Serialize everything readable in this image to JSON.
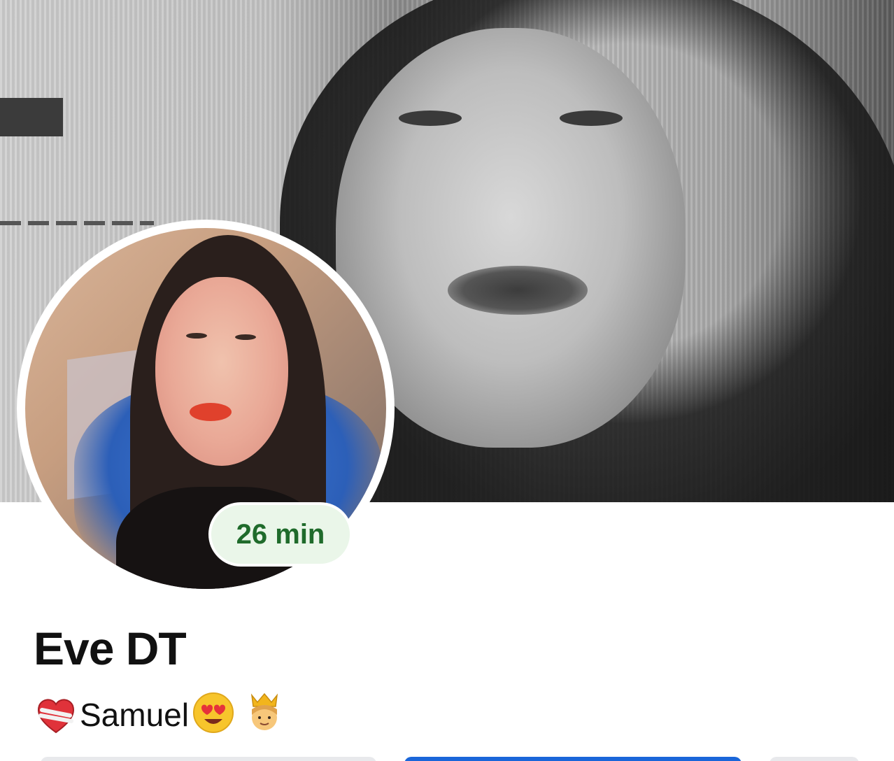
{
  "profile": {
    "name": "Eve DT",
    "status_badge": "26 min",
    "bio_text": "Samuel",
    "bio_icons": [
      "broken-heart-icon",
      "heart-eyes-face-icon",
      "prince-icon"
    ]
  },
  "colors": {
    "badge_text": "#1f6b2b",
    "badge_bg": "#eaf6e9",
    "primary_button": "#1a66d9",
    "secondary_button": "#e8e9ec"
  }
}
